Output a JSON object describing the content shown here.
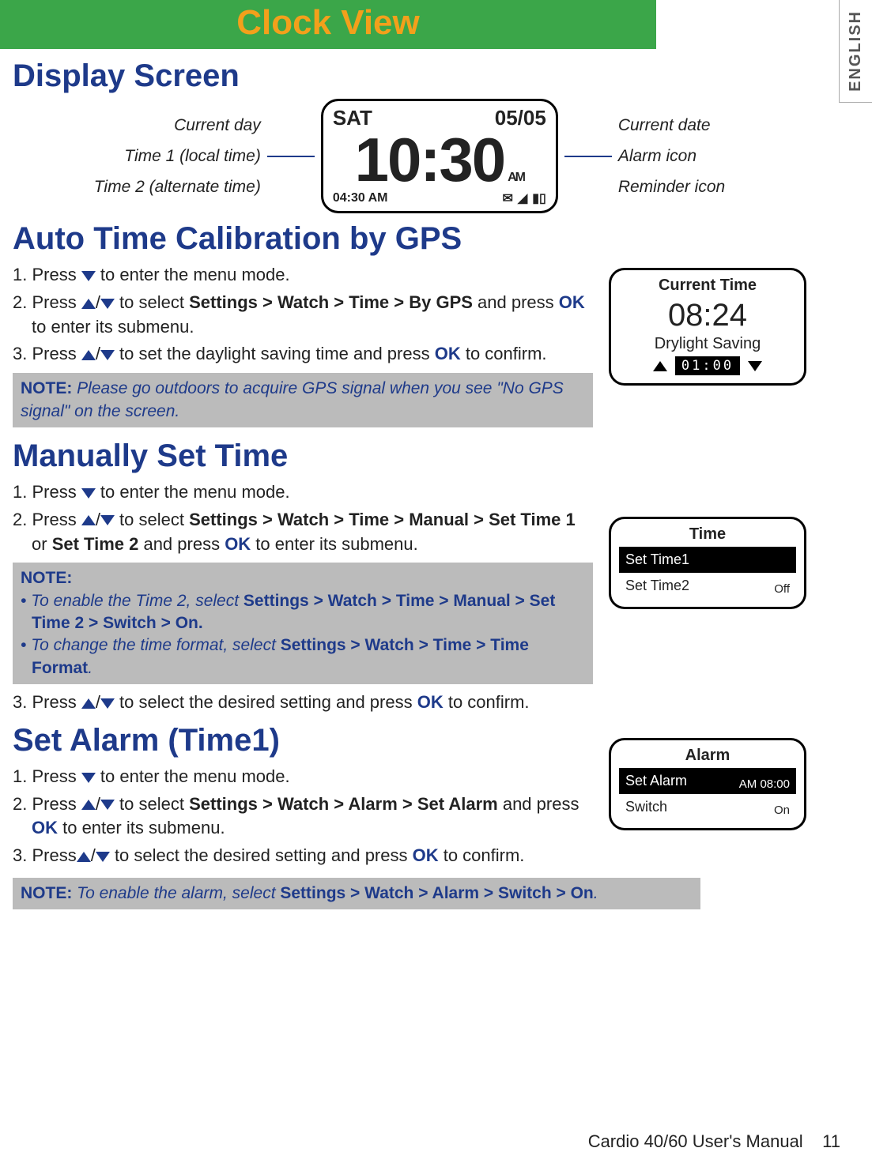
{
  "lang_tab": "ENGLISH",
  "banner_title": "Clock View",
  "section_display": "Display Screen",
  "callouts": {
    "current_day": "Current day",
    "time1": "Time 1 (local time)",
    "time2": "Time 2 (alternate time)",
    "current_date": "Current date",
    "alarm_icon": "Alarm icon",
    "reminder_icon": "Reminder icon"
  },
  "watchface": {
    "day": "SAT",
    "date": "05/05",
    "time": "10:30",
    "ampm": "AM",
    "time2": "04:30  AM"
  },
  "section_gps": "Auto Time Calibration by GPS",
  "gps_steps": {
    "s1a": "1. Press ",
    "s1b": " to enter the menu mode.",
    "s2a": "2. Press ",
    "s2b": " to select ",
    "s2path": "Settings > Watch > Time > By GPS",
    "s2c": " and press ",
    "s2d": " to enter its submenu.",
    "s3a": "3. Press ",
    "s3b": " to set the daylight saving time and press ",
    "s3c": " to confirm."
  },
  "ok_label": "OK",
  "note_gps_label": "NOTE:",
  "note_gps": " Please go outdoors to acquire GPS signal when you see \"No GPS signal\" on the screen.",
  "box_current_time": {
    "title": "Current Time",
    "value": "08:24",
    "sub": "Drylight Saving",
    "spinner": "01:00"
  },
  "section_manual": "Manually Set Time",
  "manual_steps": {
    "s1a": "1. Press ",
    "s1b": " to enter the menu mode.",
    "s2a": "2. Press ",
    "s2b": " to select ",
    "s2path": "Settings > Watch > Time > Manual > Set Time 1",
    "s2or": " or ",
    "s2path2": "Set Time 2",
    "s2c": " and press ",
    "s2d": " to enter its submenu.",
    "s3a": "3. Press ",
    "s3b": " to select the desired setting and press ",
    "s3c": " to confirm."
  },
  "note_manual_label": "NOTE:",
  "note_manual_li1a": "To enable the Time 2, select ",
  "note_manual_li1b": "Settings > Watch > Time > Manual > Set Time 2 > Switch > On.",
  "note_manual_li2a": "To change the time format, select ",
  "note_manual_li2b": "Settings > Watch > Time > Time Format",
  "box_time": {
    "title": "Time",
    "item1": "Set Time1",
    "item2": "Set Time2",
    "item2_status": "Off"
  },
  "section_alarm": "Set Alarm (Time1)",
  "alarm_steps": {
    "s1a": "1. Press ",
    "s1b": " to enter the menu mode.",
    "s2a": "2. Press ",
    "s2b": " to select ",
    "s2path": "Settings > Watch > Alarm > Set Alarm",
    "s2c": " and press ",
    "s2d": " to enter its submenu.",
    "s3a": "3. Press",
    "s3b": " to select the desired setting and press ",
    "s3c": " to confirm."
  },
  "box_alarm": {
    "title": "Alarm",
    "item1": "Set Alarm",
    "item1_status": "AM 08:00",
    "item2": "Switch",
    "item2_status": "On"
  },
  "note_alarm_label": "NOTE:",
  "note_alarm_a": " To enable the alarm, select ",
  "note_alarm_b": "Settings > Watch > Alarm > Switch > On",
  "footer_manual": "Cardio 40/60 User's Manual",
  "footer_page": "11"
}
